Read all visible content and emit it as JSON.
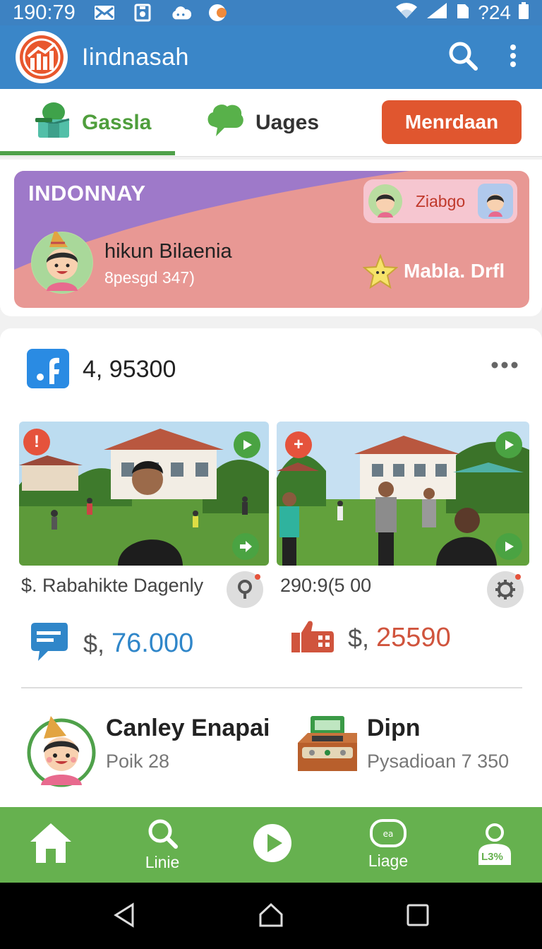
{
  "status_bar": {
    "time": "190:79",
    "battery_text": "?24",
    "icons": [
      "mail-icon",
      "screenshot-icon",
      "cloud-icon",
      "toggle-icon",
      "wifi-icon",
      "signal-icon",
      "sim-icon",
      "battery-icon"
    ]
  },
  "app_bar": {
    "title": "Iindnasah",
    "logo": "chart-logo-icon",
    "actions": [
      "search-icon",
      "more-vert-icon"
    ]
  },
  "tabs": {
    "items": [
      {
        "label": "Gassla",
        "icon": "package-icon",
        "active": true
      },
      {
        "label": "Uages",
        "icon": "chat-bubble-icon",
        "active": false
      }
    ],
    "action_button": "Menrdaan",
    "colors": {
      "active": "#4f9e3c",
      "button": "#e0562f"
    }
  },
  "banner": {
    "title": "INDONNAY",
    "name": "hikun Bilaenia",
    "subtitle": "8pesgd 347)",
    "chip_label": "Ziabgo",
    "right_label": "Mabla. Drfl",
    "colors": {
      "purple": "#a07ac9",
      "pink": "#e89894"
    }
  },
  "feed": {
    "count": "4, 95300",
    "photos": [
      {
        "caption": "$. Rabahikte Dagenly",
        "badge": "!",
        "badge_color": "#e5533c"
      },
      {
        "caption": "290:9(5 00",
        "badge": "+",
        "badge_color": "#e5533c"
      }
    ],
    "stats": [
      {
        "currency": "$,",
        "value": "76.000",
        "icon": "message-icon",
        "color": "#2f86c9"
      },
      {
        "currency": "$,",
        "value": "25590",
        "icon": "thumbs-up-icon",
        "color": "#d0543d"
      }
    ],
    "people": [
      {
        "name": "Canley Enapai",
        "sub": "Poik 28"
      },
      {
        "name": "Dipn",
        "sub": "Pysadioan 7 350"
      }
    ]
  },
  "bottom_nav": {
    "items": [
      {
        "label": "",
        "icon": "home-icon"
      },
      {
        "label": "Linie",
        "icon": "search-icon"
      },
      {
        "label": "",
        "icon": "play-icon"
      },
      {
        "label": "Liage",
        "icon": "chat-icon"
      },
      {
        "label": "",
        "icon": "profile-icon"
      }
    ],
    "profile_badge": "L3%",
    "bg": "#66b14f"
  }
}
